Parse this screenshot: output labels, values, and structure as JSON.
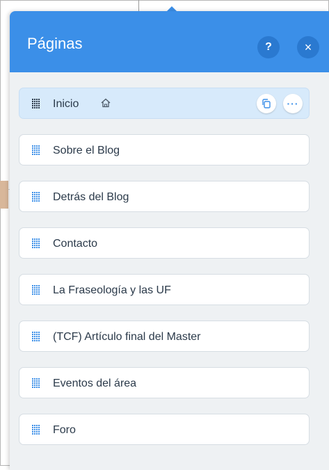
{
  "panel": {
    "title": "Páginas",
    "help_label": "?",
    "close_label": "×"
  },
  "pages": [
    {
      "label": "Inicio",
      "selected": true,
      "home": true
    },
    {
      "label": "Sobre el Blog"
    },
    {
      "label": "Detrás del Blog"
    },
    {
      "label": "Contacto"
    },
    {
      "label": "La Fraseología y las UF"
    },
    {
      "label": "(TCF) Artículo final del Master"
    },
    {
      "label": "Eventos del área"
    },
    {
      "label": "Foro"
    }
  ],
  "actions": {
    "more_label": "···"
  },
  "colors": {
    "header": "#3b8fe8",
    "panel_bg": "#eef1f3",
    "selected_row": "#d7eafb",
    "text": "#2b3a4a"
  }
}
